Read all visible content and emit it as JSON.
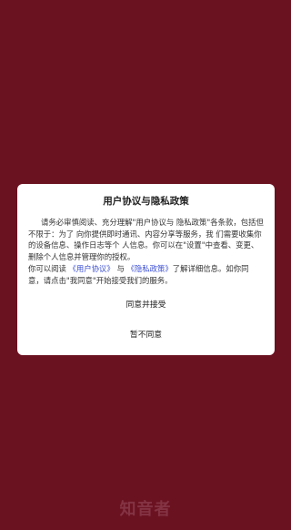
{
  "dialog": {
    "title": "用户协议与隐私政策",
    "paragraph1": "请务必审慎阅读、充分理解\"用户协议与 隐私政策\"各条款，包括但不限于：为了 向你提供即时通讯、内容分享等服务，我 们需要收集你的设备信息、操作日志等个 人信息。你可以在\"设置\"中查看、变更、删除个人信息并管理你的授权。",
    "p2_prefix": "你可以阅读",
    "link_user_agreement": "《用户协议》",
    "p2_and": "与",
    "link_privacy_policy": "《隐私政策》",
    "p2_suffix": "了解详细信息。如你同意，请点击\"我同意\"开始接受我们的服务。",
    "accept_label": "同意并接受",
    "decline_label": "暂不同意"
  },
  "brand": {
    "name": "知音者"
  },
  "colors": {
    "background": "#6b1221",
    "dialog": "#ffffff",
    "link": "#3b4fd1",
    "brand_watermark": "#833343"
  }
}
